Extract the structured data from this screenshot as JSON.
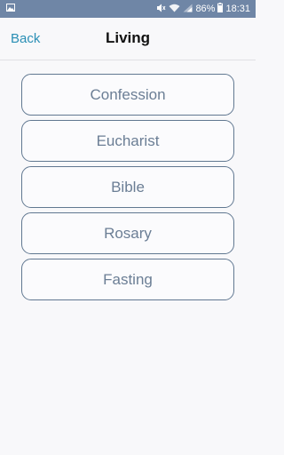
{
  "status_bar": {
    "battery": "86%",
    "time": "18:31",
    "icons": [
      "image-icon",
      "mute-icon",
      "wifi-icon",
      "signal-icon",
      "battery-icon"
    ]
  },
  "nav": {
    "back_label": "Back",
    "title": "Living"
  },
  "menu": {
    "items": [
      {
        "label": "Confession"
      },
      {
        "label": "Eucharist"
      },
      {
        "label": "Bible"
      },
      {
        "label": "Rosary"
      },
      {
        "label": "Fasting"
      }
    ]
  },
  "colors": {
    "status_bar_bg": "#6f86a6",
    "accent": "#2a8fb5",
    "button_border": "#617891",
    "button_text": "#6b7e95"
  }
}
